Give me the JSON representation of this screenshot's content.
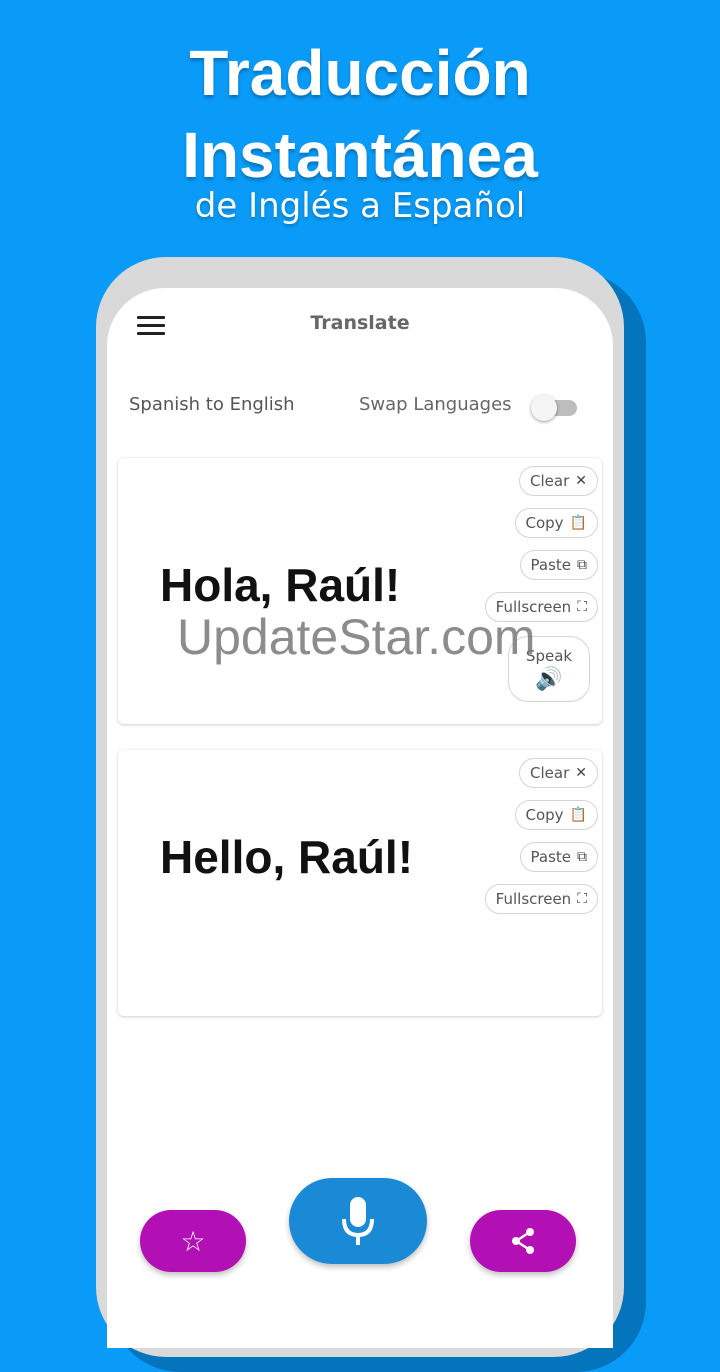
{
  "promo": {
    "title_line1": "Traducción",
    "title_line2": "Instantánea",
    "subtitle": "de Inglés a Español"
  },
  "app": {
    "title": "Translate",
    "language_direction": "Spanish to English",
    "swap_label": "Swap Languages",
    "swap_enabled": false
  },
  "source_card": {
    "text": "Hola, Raúl!",
    "buttons": {
      "clear": "Clear",
      "copy": "Copy",
      "paste": "Paste",
      "fullscreen": "Fullscreen",
      "speak": "Speak"
    }
  },
  "target_card": {
    "text": "Hello, Raúl!",
    "buttons": {
      "clear": "Clear",
      "copy": "Copy",
      "paste": "Paste",
      "fullscreen": "Fullscreen"
    }
  },
  "watermark": "UpdateStar.com",
  "bottom_bar": {
    "favorite_icon": "star-icon",
    "mic_icon": "microphone-icon",
    "share_icon": "share-icon"
  },
  "colors": {
    "background": "#0a9bf8",
    "accent_purple": "#b20fb4",
    "mic_blue": "#1a89d6"
  }
}
